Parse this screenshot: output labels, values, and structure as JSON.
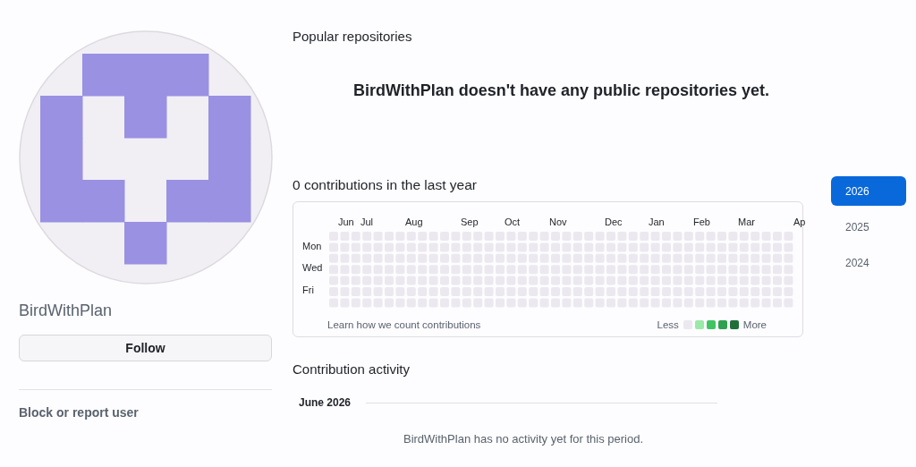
{
  "profile": {
    "name": "BirdWithPlan",
    "follow_button": "Follow",
    "block_link": "Block or report user"
  },
  "popular": {
    "title": "Popular repositories",
    "empty_message": "BirdWithPlan doesn't have any public repositories yet."
  },
  "contributions": {
    "title": "0 contributions in the last year",
    "months": [
      "Jun",
      "Jul",
      "Aug",
      "Sep",
      "Oct",
      "Nov",
      "Dec",
      "Jan",
      "Feb",
      "Mar",
      "Ap"
    ],
    "days": [
      "Mon",
      "Wed",
      "Fri"
    ],
    "learn_link": "Learn how we count contributions",
    "legend": {
      "less": "Less",
      "more": "More",
      "swatches": [
        {
          "color": "#ebe9ef"
        },
        {
          "color": "#9be9a8"
        },
        {
          "color": "#40c463"
        },
        {
          "color": "#30a14e"
        },
        {
          "color": "#216e39"
        }
      ]
    }
  },
  "years": [
    {
      "label": "2026",
      "selected": true
    },
    {
      "label": "2025",
      "selected": false
    },
    {
      "label": "2024",
      "selected": false
    }
  ],
  "activity": {
    "title": "Contribution activity",
    "period": "June 2026",
    "empty_message": "BirdWithPlan has no activity yet for this period."
  }
}
